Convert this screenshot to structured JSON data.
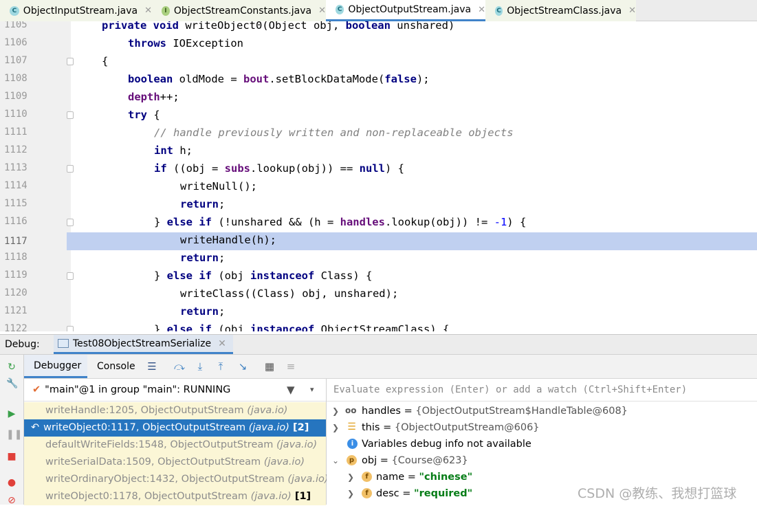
{
  "tabs": [
    {
      "label": "ObjectInputStream.java",
      "icon": "class-icon"
    },
    {
      "label": "ObjectStreamConstants.java",
      "icon": "interface-icon"
    },
    {
      "label": "ObjectOutputStream.java",
      "icon": "class-icon",
      "active": true
    },
    {
      "label": "ObjectStreamClass.java",
      "icon": "class-icon"
    }
  ],
  "editor": {
    "lines": [
      {
        "num": "1105"
      },
      {
        "num": "1106"
      },
      {
        "num": "1107"
      },
      {
        "num": "1108"
      },
      {
        "num": "1109"
      },
      {
        "num": "1110"
      },
      {
        "num": "1111"
      },
      {
        "num": "1112"
      },
      {
        "num": "1113"
      },
      {
        "num": "1114"
      },
      {
        "num": "1115"
      },
      {
        "num": "1116"
      },
      {
        "num": "1117"
      },
      {
        "num": "1118"
      },
      {
        "num": "1119"
      },
      {
        "num": "1120"
      },
      {
        "num": "1121"
      },
      {
        "num": "1122"
      }
    ],
    "code": {
      "l1105_a": "private void ",
      "l1105_b": "writeObject0(Object obj, ",
      "l1105_c": "boolean",
      "l1105_d": " unshared)",
      "l1106_a": "throws",
      "l1106_b": " IOException",
      "l1107": "{",
      "l1108_a": "boolean",
      "l1108_b": " oldMode = ",
      "l1108_c": "bout",
      "l1108_d": ".setBlockDataMode(",
      "l1108_e": "false",
      "l1108_f": ");",
      "l1109_a": "depth",
      "l1109_b": "++;",
      "l1110_a": "try",
      "l1110_b": " {",
      "l1111": "// handle previously written and non-replaceable objects",
      "l1112_a": "int",
      "l1112_b": " h;",
      "l1113_a": "if",
      "l1113_b": " ((obj = ",
      "l1113_c": "subs",
      "l1113_d": ".lookup(obj)) == ",
      "l1113_e": "null",
      "l1113_f": ") {",
      "l1114": "writeNull();",
      "l1115_a": "return",
      "l1115_b": ";",
      "l1116_a": "} ",
      "l1116_b": "else if",
      "l1116_c": " (!unshared && (h = ",
      "l1116_d": "handles",
      "l1116_e": ".lookup(obj)) != ",
      "l1116_f": "-1",
      "l1116_g": ") {",
      "l1117": "writeHandle(h);",
      "l1118_a": "return",
      "l1118_b": ";",
      "l1119_a": "} ",
      "l1119_b": "else if",
      "l1119_c": " (obj ",
      "l1119_d": "instanceof",
      "l1119_e": " Class) {",
      "l1120": "writeClass((Class) obj, unshared);",
      "l1121_a": "return",
      "l1121_b": ";",
      "l1122_a": "} ",
      "l1122_b": "else if",
      "l1122_c": " (obj ",
      "l1122_d": "instanceof",
      "l1122_e": " ObjectStreamClass) {"
    },
    "current_line": "1117"
  },
  "debug": {
    "label": "Debug:",
    "session": "Test08ObjectStreamSerialize",
    "tabs": {
      "debugger": "Debugger",
      "console": "Console"
    },
    "thread": "\"main\"@1 in group \"main\": RUNNING",
    "frames": [
      {
        "method": "writeHandle:1205, ObjectOutputStream ",
        "pkg": "(java.io)",
        "extra": ""
      },
      {
        "method": "writeObject0:1117, ObjectOutputStream ",
        "pkg": "(java.io)",
        "extra": " [2]",
        "selected": true
      },
      {
        "method": "defaultWriteFields:1548, ObjectOutputStream ",
        "pkg": "(java.io)",
        "extra": ""
      },
      {
        "method": "writeSerialData:1509, ObjectOutputStream ",
        "pkg": "(java.io)",
        "extra": ""
      },
      {
        "method": "writeOrdinaryObject:1432, ObjectOutputStream ",
        "pkg": "(java.io)",
        "extra": ""
      },
      {
        "method": "writeObject0:1178, ObjectOutputStream ",
        "pkg": "(java.io)",
        "extra": " [1]"
      }
    ],
    "eval_placeholder": "Evaluate expression (Enter) or add a watch (Ctrl+Shift+Enter)",
    "variables": [
      {
        "name": "handles",
        "value": "{ObjectOutputStream$HandleTable@608}"
      },
      {
        "name": "this",
        "value": "{ObjectOutputStream@606}"
      },
      {
        "name": "",
        "value": "Variables debug info not available"
      },
      {
        "name": "obj",
        "value": "{Course@623}"
      },
      {
        "name": "name",
        "value": "\"chinese\""
      },
      {
        "name": "desc",
        "value": "\"required\""
      }
    ]
  },
  "watermark": "CSDN @教练、我想打篮球",
  "colors": {
    "accent": "#4083c9",
    "selection": "#2675bf",
    "current_line": "#c0d0f0"
  }
}
